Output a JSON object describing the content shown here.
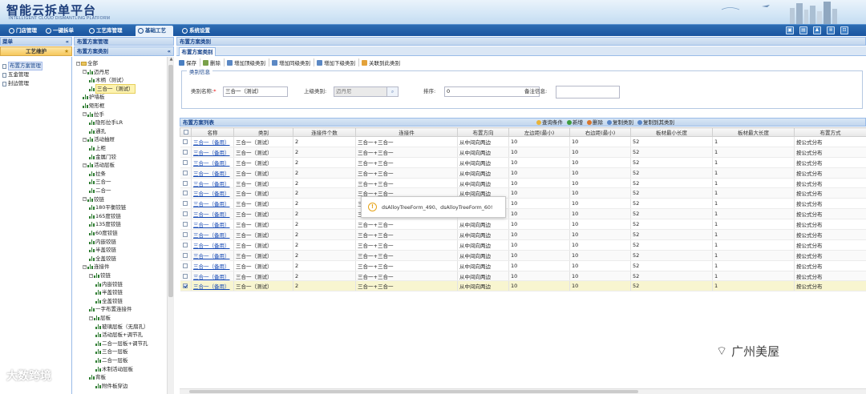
{
  "header": {
    "app_title": "智能云拆单平台",
    "app_subtitle": "INTELLIGENT CLOUD DISMANTLING PLATFORM"
  },
  "nav": {
    "tabs": [
      "门店管理",
      "一键拆单",
      "工艺库管理",
      "基础工艺",
      "系统设置"
    ],
    "active": "基础工艺"
  },
  "menu": {
    "title": "菜单",
    "section": "工艺维护",
    "items": [
      "布置方案管理",
      "五金管理",
      "封边管理"
    ],
    "selected": "布置方案管理"
  },
  "tree_panel": {
    "header": "布置方案管理",
    "subheader": "布置方案类别"
  },
  "tree": [
    {
      "label": "全部",
      "level": 0,
      "toggle": "−",
      "icon": "folder"
    },
    {
      "label": "迈丹尼",
      "level": 1,
      "toggle": "−",
      "icon": "chart"
    },
    {
      "label": "木柄（测试）",
      "level": 2,
      "toggle": "",
      "icon": "chart"
    },
    {
      "label": "三合一（测试）",
      "level": 2,
      "toggle": "",
      "icon": "chart",
      "selected": true
    },
    {
      "label": "护墙板",
      "level": 1,
      "toggle": "",
      "icon": "chart"
    },
    {
      "label": "矩形框",
      "level": 1,
      "toggle": "",
      "icon": "chart"
    },
    {
      "label": "拉手",
      "level": 1,
      "toggle": "−",
      "icon": "chart"
    },
    {
      "label": "隐形拉手LR",
      "level": 2,
      "toggle": "",
      "icon": "chart"
    },
    {
      "label": "通孔",
      "level": 2,
      "toggle": "",
      "icon": "chart"
    },
    {
      "label": "活动抽屉",
      "level": 1,
      "toggle": "−",
      "icon": "chart"
    },
    {
      "label": "上柜",
      "level": 2,
      "toggle": "",
      "icon": "chart"
    },
    {
      "label": "金属门铰",
      "level": 2,
      "toggle": "",
      "icon": "chart"
    },
    {
      "label": "活动层板",
      "level": 1,
      "toggle": "−",
      "icon": "chart"
    },
    {
      "label": "拉条",
      "level": 2,
      "toggle": "",
      "icon": "chart"
    },
    {
      "label": "三合一",
      "level": 2,
      "toggle": "",
      "icon": "chart"
    },
    {
      "label": "二合一",
      "level": 2,
      "toggle": "",
      "icon": "chart"
    },
    {
      "label": "铰链",
      "level": 1,
      "toggle": "−",
      "icon": "chart"
    },
    {
      "label": "180平衡铰链",
      "level": 2,
      "toggle": "",
      "icon": "chart"
    },
    {
      "label": "165度铰链",
      "level": 2,
      "toggle": "",
      "icon": "chart"
    },
    {
      "label": "135度铰链",
      "level": 2,
      "toggle": "",
      "icon": "chart"
    },
    {
      "label": "60度铰链",
      "level": 2,
      "toggle": "",
      "icon": "chart"
    },
    {
      "label": "内嵌铰链",
      "level": 2,
      "toggle": "",
      "icon": "chart"
    },
    {
      "label": "半盖铰链",
      "level": 2,
      "toggle": "",
      "icon": "chart"
    },
    {
      "label": "全盖铰链",
      "level": 2,
      "toggle": "",
      "icon": "chart"
    },
    {
      "label": "连接件",
      "level": 1,
      "toggle": "−",
      "icon": "chart"
    },
    {
      "label": "铰链",
      "level": 2,
      "toggle": "−",
      "icon": "chart"
    },
    {
      "label": "内嵌铰链",
      "level": 3,
      "toggle": "",
      "icon": "chart"
    },
    {
      "label": "半盖铰链",
      "level": 3,
      "toggle": "",
      "icon": "chart"
    },
    {
      "label": "全盖铰链",
      "level": 3,
      "toggle": "",
      "icon": "chart"
    },
    {
      "label": "一字布置连接件",
      "level": 2,
      "toggle": "",
      "icon": "chart"
    },
    {
      "label": "层板",
      "level": 2,
      "toggle": "−",
      "icon": "chart"
    },
    {
      "label": "玻璃层板（无扇孔）",
      "level": 3,
      "toggle": "",
      "icon": "chart"
    },
    {
      "label": "活动层板+调节孔",
      "level": 3,
      "toggle": "",
      "icon": "chart"
    },
    {
      "label": "二合一层板+调节孔",
      "level": 3,
      "toggle": "",
      "icon": "chart"
    },
    {
      "label": "三合一层板",
      "level": 3,
      "toggle": "",
      "icon": "chart"
    },
    {
      "label": "二合一层板",
      "level": 3,
      "toggle": "",
      "icon": "chart"
    },
    {
      "label": "木制活动层板",
      "level": 3,
      "toggle": "",
      "icon": "chart"
    },
    {
      "label": "背板",
      "level": 2,
      "toggle": "",
      "icon": "chart"
    },
    {
      "label": "附件板穿边",
      "level": 3,
      "toggle": "",
      "icon": "chart"
    }
  ],
  "main": {
    "header": "布置方案类别",
    "tab": "布置方案类别",
    "toolbar": [
      "保存",
      "删除",
      "增加顶级类别",
      "增加同级类别",
      "增加下级类别",
      "关联到此类别"
    ]
  },
  "form": {
    "legend": "类别信息",
    "name_label": "类别名称:",
    "name_value": "三合一（测试）",
    "parent_label": "上级类别:",
    "parent_value": "迈丹尼",
    "order_label": "排序:",
    "order_value": "0",
    "remark_label": "备注信息:",
    "remark_value": ""
  },
  "grid": {
    "title": "布置方案列表",
    "actions": [
      "查询条件",
      "新增",
      "删除",
      "复制类别",
      "复制到其类别"
    ],
    "columns": [
      "名称",
      "类别",
      "连接件个数",
      "连接件",
      "布置方向",
      "左边距(最小)",
      "右边距(最小)",
      "板材最小长度",
      "板材最大长度",
      "布置方式"
    ],
    "rows": [
      [
        "三合一（备用）",
        "三合一（测试）",
        "2",
        "三合一+三合一",
        "从中间向两边",
        "10",
        "10",
        "52",
        "1",
        "按公式分布"
      ],
      [
        "三合一（备用）",
        "三合一（测试）",
        "2",
        "三合一+三合一",
        "从中间向两边",
        "10",
        "10",
        "52",
        "1",
        "按公式分布"
      ],
      [
        "三合一（备用）",
        "三合一（测试）",
        "2",
        "三合一+三合一",
        "从中间向两边",
        "10",
        "10",
        "52",
        "1",
        "按公式分布"
      ],
      [
        "三合一（备用）",
        "三合一（测试）",
        "2",
        "三合一+三合一",
        "从中间向两边",
        "10",
        "10",
        "52",
        "1",
        "按公式分布"
      ],
      [
        "三合一（备用）",
        "三合一（测试）",
        "2",
        "三合一+三合一",
        "从中间向两边",
        "10",
        "10",
        "52",
        "1",
        "按公式分布"
      ],
      [
        "三合一（备用）",
        "三合一（测试）",
        "2",
        "三合一+三合一",
        "从中间向两边",
        "10",
        "10",
        "52",
        "1",
        "按公式分布"
      ],
      [
        "三合一（备用）",
        "三合一（测试）",
        "2",
        "三合一+三合一",
        "从中间向两边",
        "10",
        "10",
        "52",
        "1",
        "按公式分布"
      ],
      [
        "三合一（备用）",
        "三合一（测试）",
        "2",
        "三合一+三合一",
        "从中间向两边",
        "10",
        "10",
        "52",
        "1",
        "按公式分布"
      ],
      [
        "三合一（备用）",
        "三合一（测试）",
        "2",
        "三合一+三合一",
        "从中间向两边",
        "10",
        "10",
        "52",
        "1",
        "按公式分布"
      ],
      [
        "三合一（备用）",
        "三合一（测试）",
        "2",
        "三合一+三合一",
        "从中间向两边",
        "10",
        "10",
        "52",
        "1",
        "按公式分布"
      ],
      [
        "三合一（备用）",
        "三合一（测试）",
        "2",
        "三合一+三合一",
        "从中间向两边",
        "10",
        "10",
        "52",
        "1",
        "按公式分布"
      ],
      [
        "三合一（备用）",
        "三合一（测试）",
        "2",
        "三合一+三合一",
        "从中间向两边",
        "10",
        "10",
        "52",
        "1",
        "按公式分布"
      ],
      [
        "三合一（备用）",
        "三合一（测试）",
        "2",
        "三合一+三合一",
        "从中间向两边",
        "10",
        "10",
        "52",
        "1",
        "按公式分布"
      ],
      [
        "三合一（备用）",
        "三合一（测试）",
        "2",
        "三合一+三合一",
        "从中间向两边",
        "10",
        "10",
        "52",
        "1",
        "按公式分布"
      ],
      [
        "三合一（备用）",
        "三合一（测试）",
        "2",
        "三合一+三合一",
        "从中间向两边",
        "10",
        "10",
        "52",
        "1",
        "按公式分布"
      ]
    ],
    "selected_row": 14
  },
  "tooltip": {
    "text": "dsAlloyTreeForm_490、dsAlloyTreeForm_60!"
  },
  "watermarks": {
    "left": "大数跨境",
    "right": "广州美屋"
  },
  "colors": {
    "nav_bg": "#1a55a0",
    "accent": "#15428b",
    "selected_row": "#f8f5d0"
  }
}
